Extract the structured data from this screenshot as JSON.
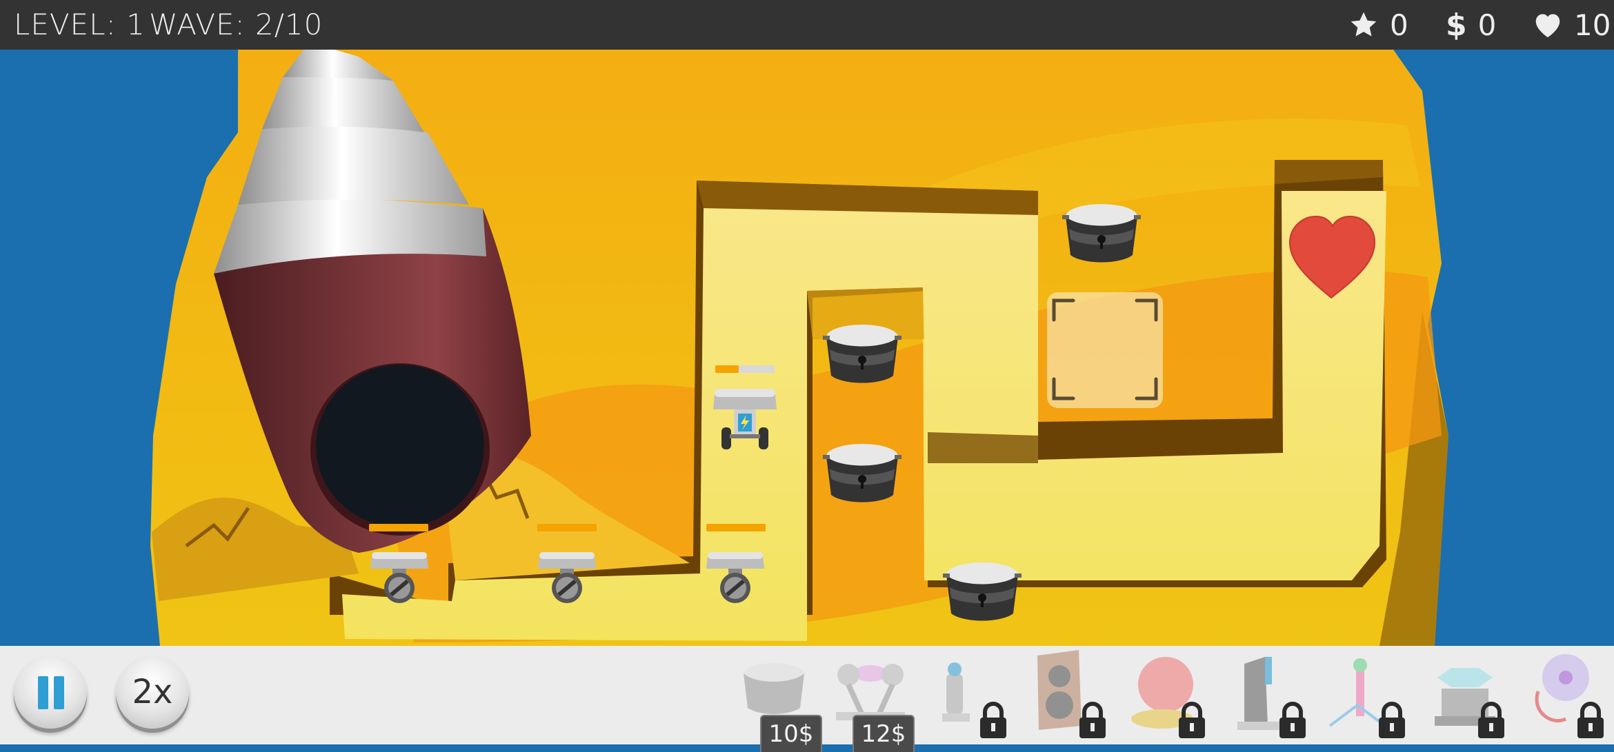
{
  "hud": {
    "level_label": "LEVEL: 1",
    "wave_label": "WAVE: 2/10",
    "stars": "0",
    "money": "0",
    "lives": "10"
  },
  "controls": {
    "speed_label": "2x"
  },
  "shop": {
    "items": [
      {
        "name": "basic turret",
        "price": "10$",
        "locked": false
      },
      {
        "name": "tesla turret",
        "price": "12$",
        "locked": false
      },
      {
        "name": "antenna tower",
        "locked": true
      },
      {
        "name": "speaker tower",
        "locked": true
      },
      {
        "name": "plasma orb tower",
        "locked": true
      },
      {
        "name": "laser tower",
        "locked": true
      },
      {
        "name": "beam tower",
        "locked": true
      },
      {
        "name": "hex platform tower",
        "locked": true
      },
      {
        "name": "electro globe tower",
        "locked": true
      }
    ]
  },
  "colors": {
    "hud_bg": "#333333",
    "water": "#1b6fae",
    "sand": "#f1b81c",
    "path": "#f7e27b",
    "accent_blue": "#2f9fd3",
    "health_orange": "#f5a300",
    "heart_red": "#e24a3b"
  },
  "enemies": [
    {
      "type": "wheeled robot",
      "health_fraction": 1.0
    },
    {
      "type": "wheeled robot",
      "health_fraction": 1.0
    },
    {
      "type": "wheeled robot",
      "health_fraction": 1.0
    },
    {
      "type": "battery robot",
      "health_fraction": 0.4
    }
  ],
  "towers_on_map": 4
}
